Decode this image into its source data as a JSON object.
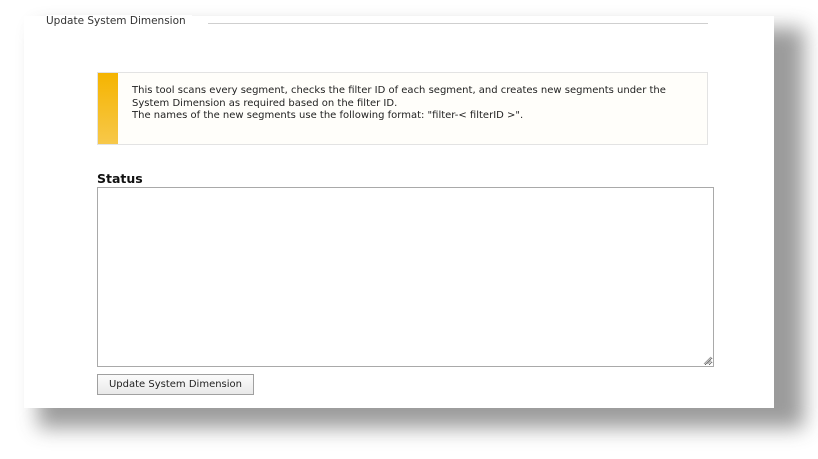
{
  "fieldset": {
    "legend": "Update System Dimension"
  },
  "info": {
    "lines": [
      "This tool scans every segment, checks the filter ID of each segment, and creates new segments under the",
      "System Dimension as required based on the filter ID.",
      "The names of the new segments use the following format: \"filter-< filterID >\"."
    ],
    "accent_color": "#f5b400"
  },
  "status": {
    "label": "Status",
    "value": ""
  },
  "actions": {
    "update_label": "Update System Dimension"
  },
  "icons": {
    "resize_grip": "resize-grip-icon"
  }
}
